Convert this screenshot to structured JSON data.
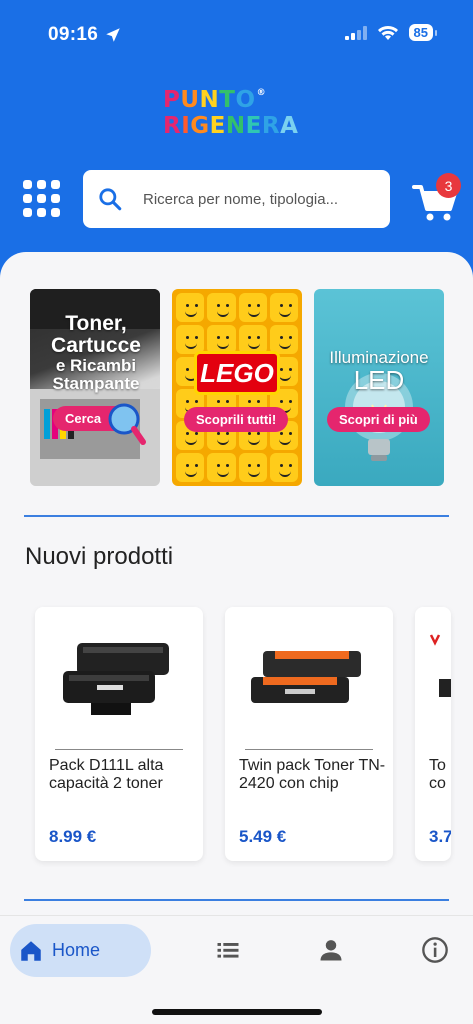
{
  "status_bar": {
    "time": "09:16",
    "battery": "85"
  },
  "logo": {
    "line1": [
      "P",
      "U",
      "N",
      "T",
      "O"
    ],
    "line2": [
      "R",
      "I",
      "G",
      "E",
      "N",
      "E",
      "R",
      "A"
    ],
    "reg": "®"
  },
  "search": {
    "placeholder": "Ricerca per nome, tipologia..."
  },
  "cart": {
    "count": "3"
  },
  "banners": [
    {
      "title_lines": [
        "Toner,",
        "Cartucce",
        "e Ricambi",
        "Stampante"
      ],
      "button": "Cerca"
    },
    {
      "logo_text": "LEGO",
      "button": "Scoprili tutti!"
    },
    {
      "title_lines": [
        "Illuminazione",
        "LED"
      ],
      "button": "Scopri di più"
    }
  ],
  "section": {
    "title": "Nuovi prodotti"
  },
  "products": [
    {
      "name": "Pack D111L alta capacità 2 toner",
      "price": "8.99 €"
    },
    {
      "name": "Twin pack Toner TN-2420 con chip",
      "price": "5.49 €"
    },
    {
      "name": "To co",
      "price": "3.7"
    }
  ],
  "bottom_nav": {
    "home_label": "Home"
  },
  "colors": {
    "brand_blue": "#1a6fe6",
    "accent_pink": "#e5266e",
    "badge_red": "#e8383d",
    "price_blue": "#1a56c8"
  },
  "icons": [
    "location-arrow-icon",
    "signal-icon",
    "wifi-icon",
    "battery-icon",
    "grid-menu-icon",
    "search-icon",
    "cart-icon",
    "home-icon",
    "list-icon",
    "person-icon",
    "info-icon"
  ]
}
